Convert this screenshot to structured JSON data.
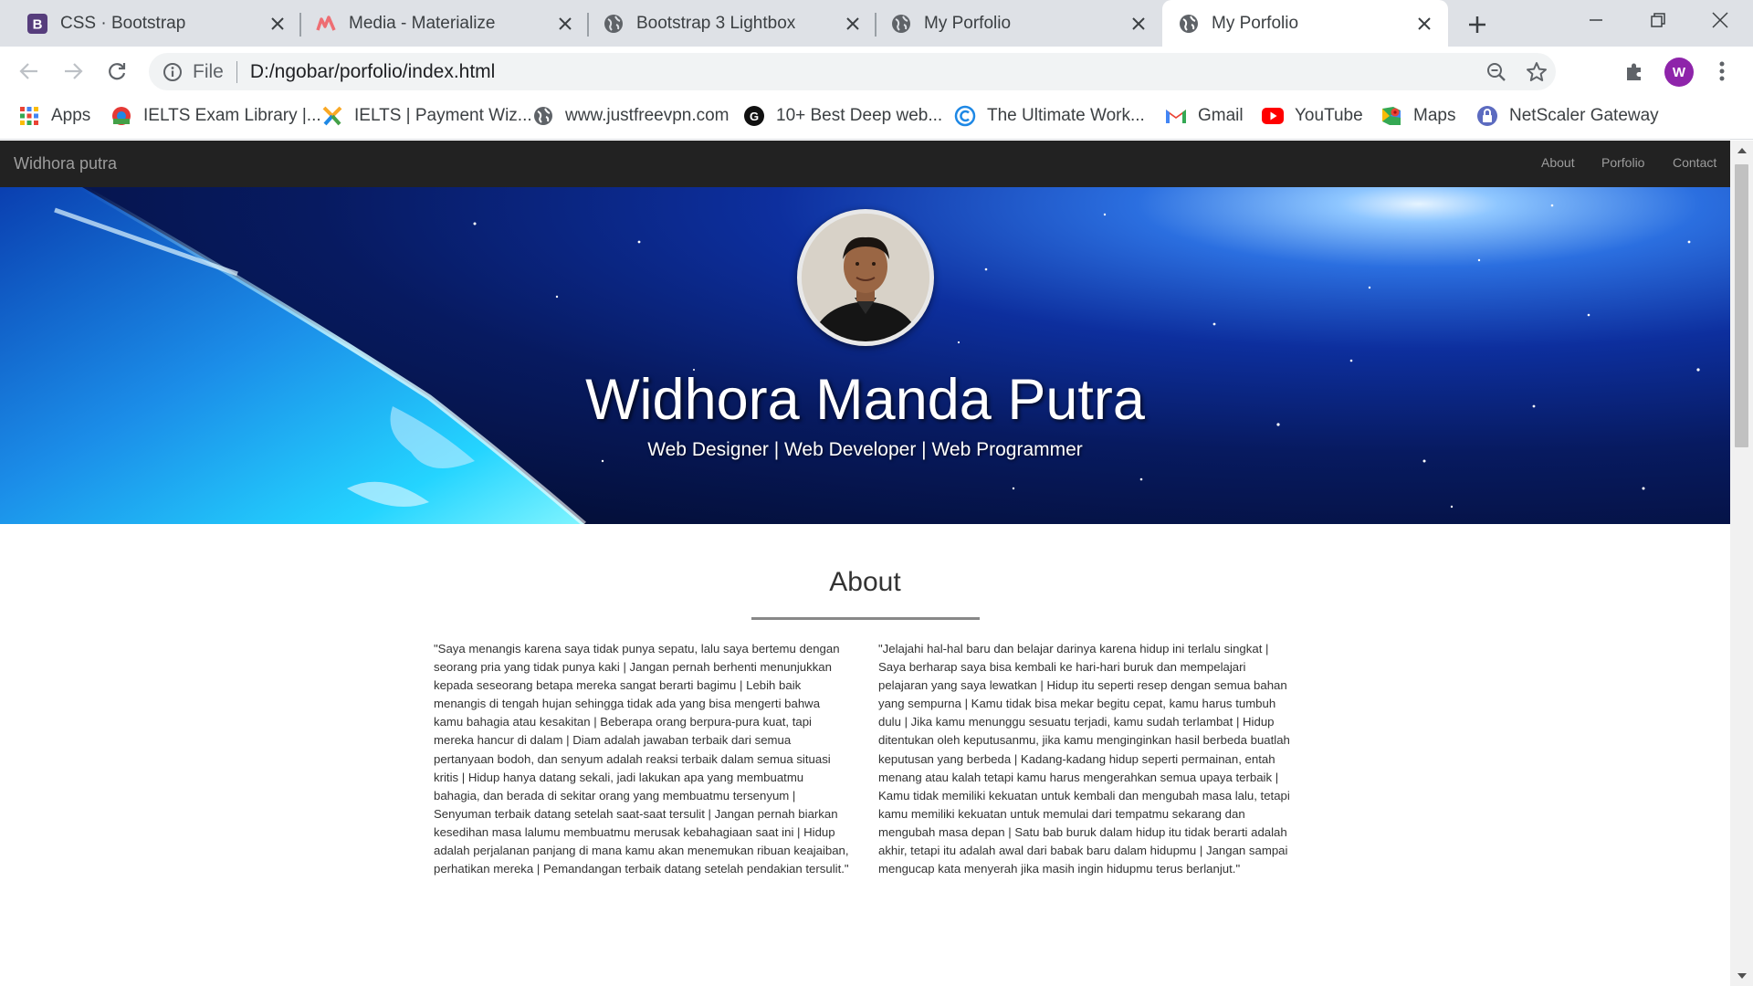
{
  "browser": {
    "tabs": [
      {
        "title": "CSS · Bootstrap",
        "icon": "bootstrap-icon"
      },
      {
        "title": "Media - Materialize",
        "icon": "materialize-icon"
      },
      {
        "title": "Bootstrap 3 Lightbox",
        "icon": "globe-icon"
      },
      {
        "title": "My Porfolio",
        "icon": "globe-icon"
      },
      {
        "title": "My Porfolio",
        "icon": "globe-icon"
      }
    ],
    "omnibox": {
      "scheme": "File",
      "url": "D:/ngobar/porfolio/index.html"
    },
    "profile_initial": "W",
    "bookmarks": [
      {
        "label": "Apps",
        "icon": "apps-grid-icon"
      },
      {
        "label": "IELTS Exam Library |...",
        "icon": "ielts-icon"
      },
      {
        "label": "IELTS | Payment Wiz...",
        "icon": "payment-icon"
      },
      {
        "label": "www.justfreevpn.com",
        "icon": "globe-icon"
      },
      {
        "label": "10+ Best Deep web...",
        "icon": "g-circle-icon"
      },
      {
        "label": "The Ultimate Work...",
        "icon": "c-circle-icon"
      },
      {
        "label": "Gmail",
        "icon": "gmail-icon"
      },
      {
        "label": "YouTube",
        "icon": "youtube-icon"
      },
      {
        "label": "Maps",
        "icon": "maps-icon"
      },
      {
        "label": "NetScaler Gateway",
        "icon": "lock-icon"
      }
    ],
    "colors": {
      "tabstrip": "#dee1e6",
      "omnibox": "#f1f3f4",
      "avatar": "#8e24aa",
      "youtube": "#ff0000"
    }
  },
  "site": {
    "brand": "Widhora putra",
    "nav": [
      "About",
      "Porfolio",
      "Contact"
    ],
    "hero": {
      "name": "Widhora Manda Putra",
      "subtitle": "Web Designer | Web Developer | Web Programmer"
    },
    "about": {
      "title": "About",
      "left": "\"Saya menangis karena saya tidak punya sepatu, lalu saya bertemu dengan seorang pria yang tidak punya kaki | Jangan pernah berhenti menunjukkan kepada seseorang betapa mereka sangat berarti bagimu | Lebih baik menangis di tengah hujan sehingga tidak ada yang bisa mengerti bahwa kamu bahagia atau kesakitan | Beberapa orang berpura-pura kuat, tapi mereka hancur di dalam | Diam adalah jawaban terbaik dari semua pertanyaan bodoh, dan senyum adalah reaksi terbaik dalam semua situasi kritis | Hidup hanya datang sekali, jadi lakukan apa yang membuatmu bahagia, dan berada di sekitar orang yang membuatmu tersenyum | Senyuman terbaik datang setelah saat-saat tersulit | Jangan pernah biarkan kesedihan masa lalumu membuatmu merusak kebahagiaan saat ini | Hidup adalah perjalanan panjang di mana kamu akan menemukan ribuan keajaiban, perhatikan mereka | Pemandangan terbaik datang setelah pendakian tersulit.\"",
      "right": "\"Jelajahi hal-hal baru dan belajar darinya karena hidup ini terlalu singkat | Saya berharap saya bisa kembali ke hari-hari buruk dan mempelajari pelajaran yang saya lewatkan | Hidup itu seperti resep dengan semua bahan yang sempurna | Kamu tidak bisa mekar begitu cepat, kamu harus tumbuh dulu | Jika kamu menunggu sesuatu terjadi, kamu sudah terlambat | Hidup ditentukan oleh keputusanmu, jika kamu menginginkan hasil berbeda buatlah keputusan yang berbeda | Kadang-kadang hidup seperti permainan, entah menang atau kalah tetapi kamu harus mengerahkan semua upaya terbaik | Kamu tidak memiliki kekuatan untuk kembali dan mengubah masa lalu, tetapi kamu memiliki kekuatan untuk memulai dari tempatmu sekarang dan mengubah masa depan | Satu bab buruk dalam hidup itu tidak berarti adalah akhir, tetapi itu adalah awal dari babak baru dalam hidupmu | Jangan sampai mengucap kata menyerah jika masih ingin hidupmu terus berlanjut.\""
    },
    "colors": {
      "navbar": "#222222",
      "nav_text": "#9d9d9d",
      "body_text": "#333333"
    }
  }
}
